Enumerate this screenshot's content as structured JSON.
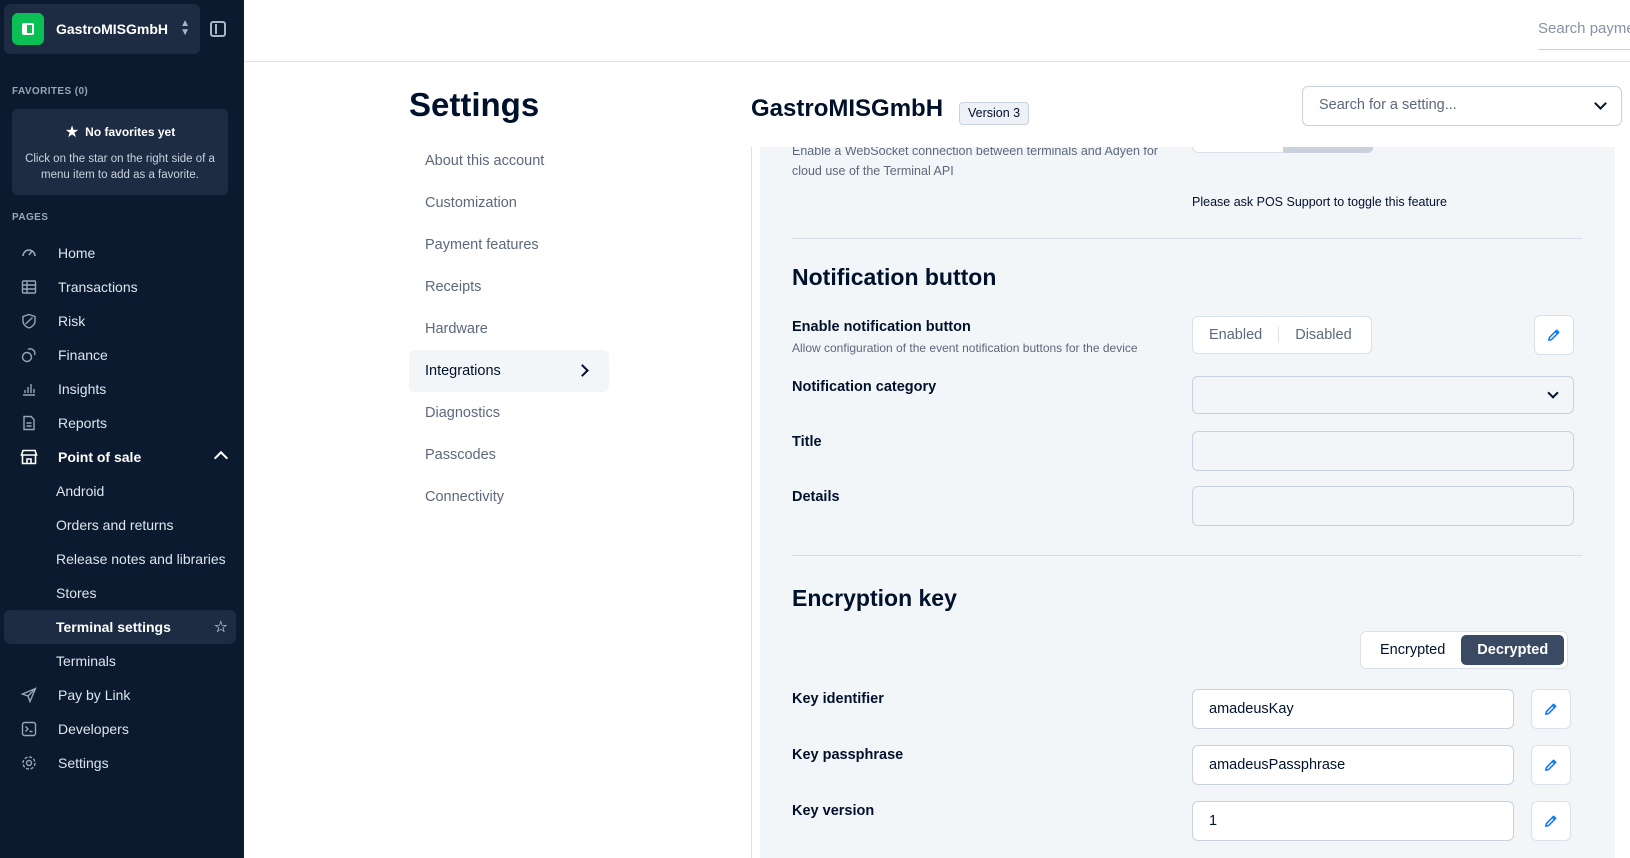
{
  "sidebar": {
    "company": "GastroMISGmbH",
    "favorites_label": "FAVORITES (0)",
    "fav_title": "No favorites yet",
    "fav_desc": "Click on the star on the right side of a menu item to add as a favorite.",
    "pages_label": "PAGES",
    "items": [
      {
        "label": "Home",
        "icon": "home-icon"
      },
      {
        "label": "Transactions",
        "icon": "table-icon"
      },
      {
        "label": "Risk",
        "icon": "shield-icon"
      },
      {
        "label": "Finance",
        "icon": "coins-icon"
      },
      {
        "label": "Insights",
        "icon": "bar-chart-icon"
      },
      {
        "label": "Reports",
        "icon": "document-icon"
      },
      {
        "label": "Point of sale",
        "icon": "store-icon"
      }
    ],
    "pos_sub": [
      "Android",
      "Orders and returns",
      "Release notes and libraries",
      "Stores",
      "Terminal settings",
      "Terminals"
    ],
    "bottom_items": [
      {
        "label": "Pay by Link",
        "icon": "send-icon"
      },
      {
        "label": "Developers",
        "icon": "terminal-icon"
      },
      {
        "label": "Settings",
        "icon": "gear-icon"
      }
    ]
  },
  "topbar": {
    "search_placeholder": "Search payme"
  },
  "settings": {
    "title": "Settings",
    "nav": [
      "About this account",
      "Customization",
      "Payment features",
      "Receipts",
      "Hardware",
      "Integrations",
      "Diagnostics",
      "Passcodes",
      "Connectivity"
    ],
    "active": "Integrations"
  },
  "header": {
    "account": "GastroMISGmbH",
    "version": "Version 3",
    "search_placeholder": "Search for a setting..."
  },
  "content": {
    "websocket_desc": "Enable a WebSocket connection between terminals and Adyen for cloud use of the Terminal API",
    "pos_support_note": "Please ask POS Support to toggle this feature",
    "notif_heading": "Notification button",
    "enable_notif_label": "Enable notification button",
    "enable_notif_desc": "Allow configuration of the event notification buttons for the device",
    "enabled": "Enabled",
    "disabled": "Disabled",
    "notif_category": "Notification category",
    "title_label": "Title",
    "details_label": "Details",
    "enc_heading": "Encryption key",
    "encrypted": "Encrypted",
    "decrypted": "Decrypted",
    "key_identifier_label": "Key identifier",
    "key_identifier": "amadeusKay",
    "key_passphrase_label": "Key passphrase",
    "key_passphrase": "amadeusPassphrase",
    "key_version_label": "Key version",
    "key_version": "1"
  },
  "colors": {
    "accent": "#0abf53",
    "sidebar_bg": "#0b1a2f",
    "link_blue": "#0070f5"
  }
}
